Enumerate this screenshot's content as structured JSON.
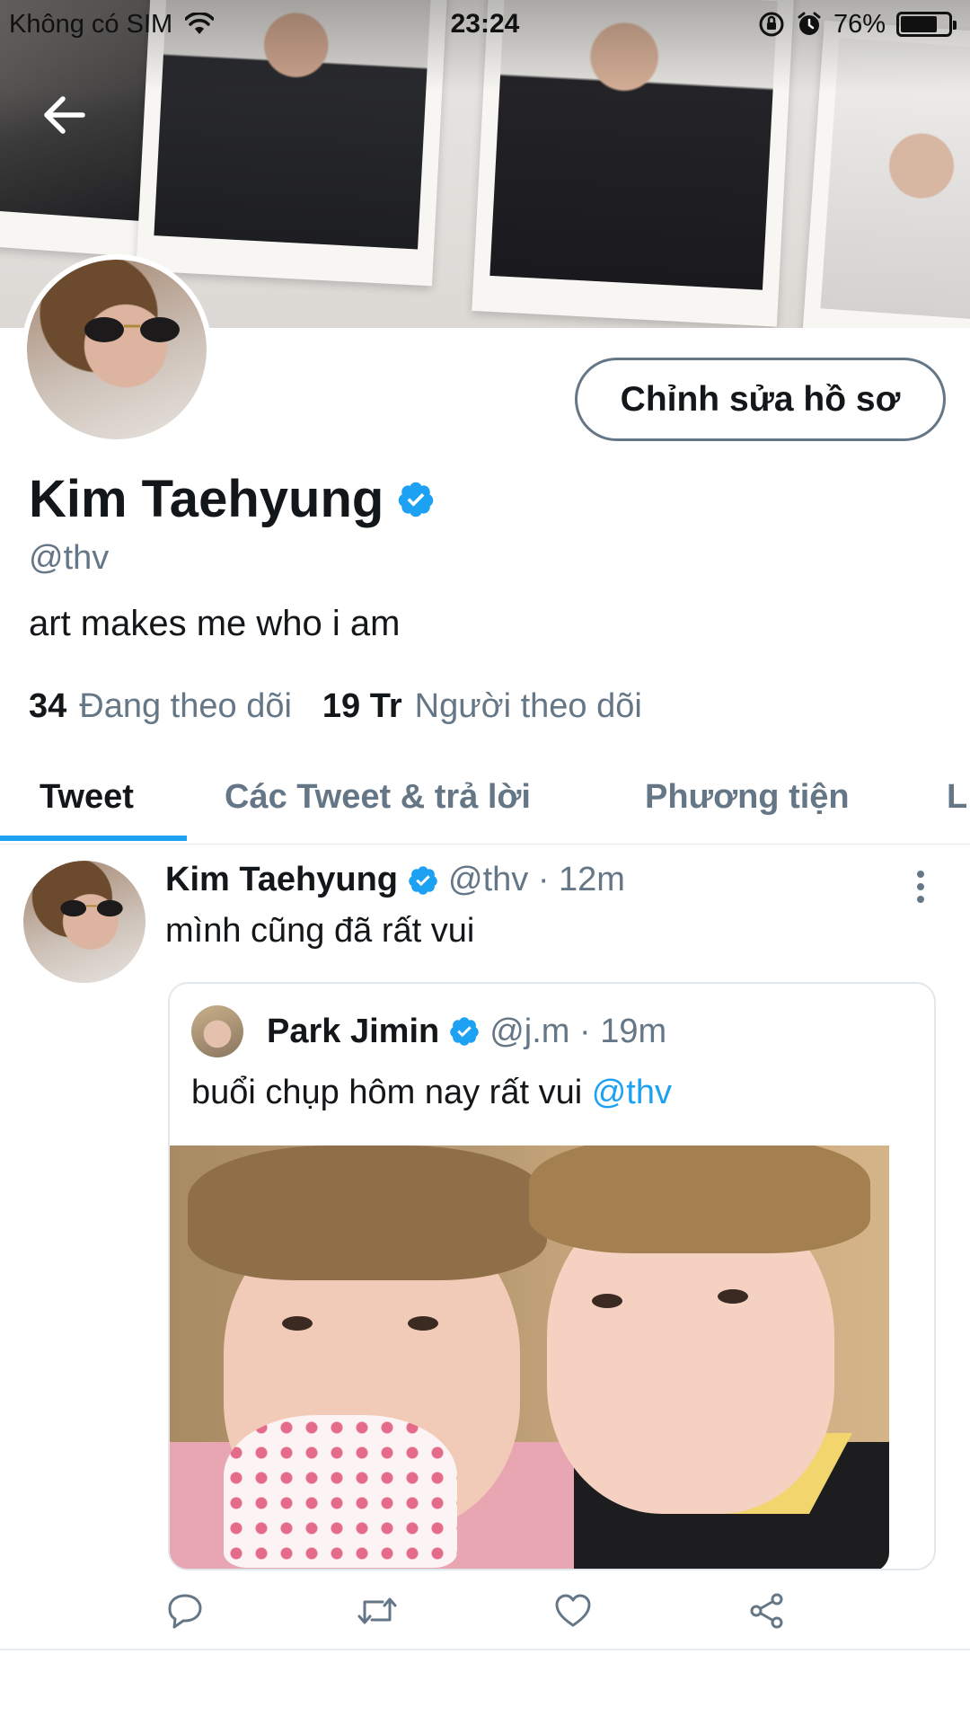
{
  "status_bar": {
    "carrier": "Không có SIM",
    "time": "23:24",
    "battery": "76%",
    "battery_level": 0.76
  },
  "profile": {
    "name": "Kim Taehyung",
    "handle": "@thv",
    "bio": "art makes me who i am",
    "edit_button": "Chỉnh sửa hồ sơ",
    "following_count": "34",
    "following_label": "Đang theo dõi",
    "followers_count": "19 Tr",
    "followers_label": "Người theo dõi"
  },
  "tabs": [
    {
      "label": "Tweet",
      "active": true
    },
    {
      "label": "Các Tweet & trả lời",
      "active": false
    },
    {
      "label": "Phương tiện",
      "active": false
    },
    {
      "label": "L",
      "active": false
    }
  ],
  "tweet": {
    "author": "Kim Taehyung",
    "meta": "@thv · 12m",
    "text": "mình cũng đã rất vui",
    "quote": {
      "author": "Park Jimin",
      "meta": "@j.m · 19m",
      "text": "buổi chụp hôm nay rất vui ",
      "mention": "@thv"
    },
    "actions": [
      "reply-icon",
      "retweet-icon",
      "like-icon",
      "share-icon"
    ]
  },
  "colors": {
    "accent": "#1da1f2",
    "text": "#14171a",
    "secondary": "#657786"
  }
}
